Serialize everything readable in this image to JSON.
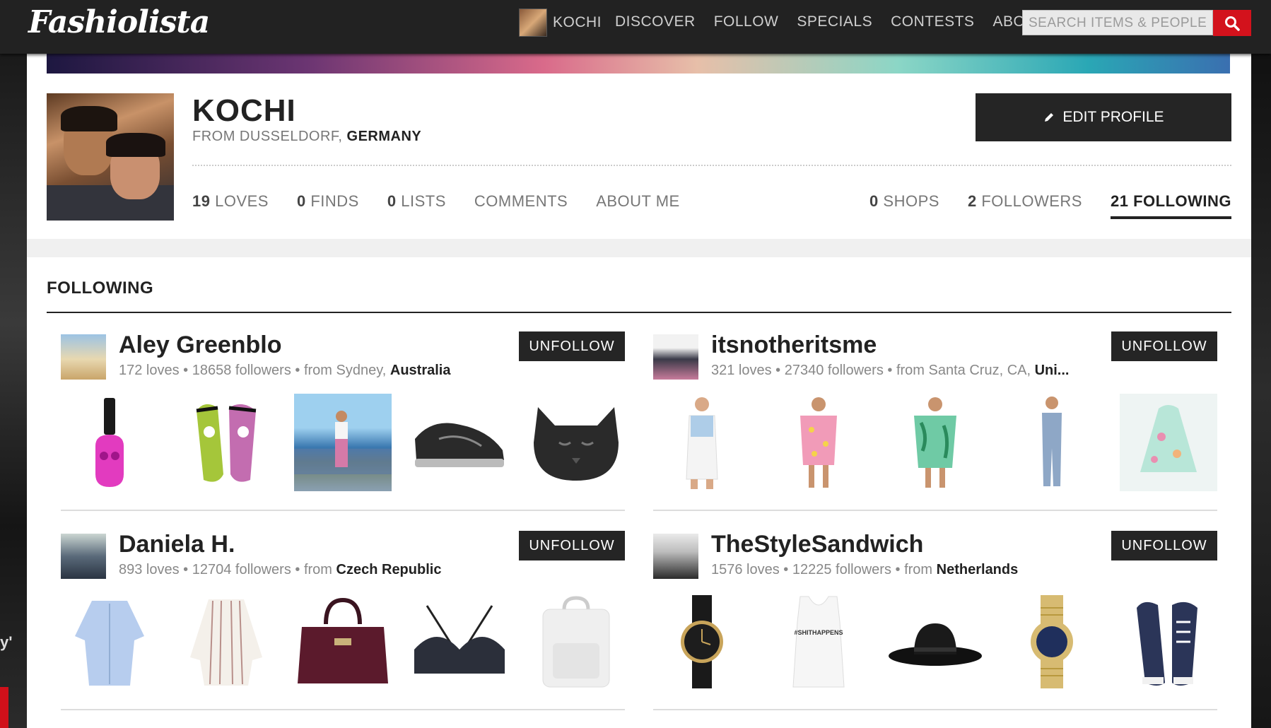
{
  "brand": {
    "logo": "Fashiolista"
  },
  "nav": {
    "user_label": "KOCHI",
    "links": [
      "DISCOVER",
      "FOLLOW",
      "SPECIALS",
      "CONTESTS",
      "ABOUT"
    ],
    "search_placeholder": "SEARCH ITEMS & PEOPLE"
  },
  "profile": {
    "name": "KOCHI",
    "from_prefix": "FROM DUSSELDORF,",
    "country": "GERMANY",
    "edit_label": "EDIT PROFILE",
    "stats_left": [
      {
        "count": "19",
        "label": "LOVES"
      },
      {
        "count": "0",
        "label": "FINDS"
      },
      {
        "count": "0",
        "label": "LISTS"
      },
      {
        "count": "",
        "label": "COMMENTS"
      },
      {
        "count": "",
        "label": "ABOUT ME"
      }
    ],
    "stats_right": [
      {
        "count": "0",
        "label": "SHOPS"
      },
      {
        "count": "2",
        "label": "FOLLOWERS"
      },
      {
        "count": "21",
        "label": "FOLLOWING"
      }
    ]
  },
  "following": {
    "title": "FOLLOWING",
    "unfollow_label": "UNFOLLOW",
    "users": [
      {
        "name": "Aley Greenblo",
        "loves": "172 loves",
        "followers": "18658 followers",
        "from_prefix": "from Sydney,",
        "location": "Australia",
        "items": [
          "pink skull nail polish",
          "zombie slip-on sneakers",
          "street style photo",
          "black running sneaker",
          "cat face handbag"
        ]
      },
      {
        "name": "itsnotheritsme",
        "loves": "321 loves",
        "followers": "27340 followers",
        "from_prefix": "from Santa Cruz, CA,",
        "location": "Uni...",
        "items": [
          "white distressed overalls",
          "pink printed dress",
          "tropical print dress",
          "denim jumpsuit",
          "mint floral skater dress"
        ]
      },
      {
        "name": "Daniela H.",
        "loves": "893 loves",
        "followers": "12704 followers",
        "from_prefix": "from",
        "location": "Czech Republic",
        "items": [
          "light blue shirt",
          "striped oversized shirt",
          "burgundy satchel bag",
          "black lace bralette",
          "white backpack"
        ]
      },
      {
        "name": "TheStyleSandwich",
        "loves": "1576 loves",
        "followers": "12225 followers",
        "from_prefix": "from",
        "location": "Netherlands",
        "items": [
          "black leather watch",
          "#SHITHAPPENS tank top",
          "black wide brim hat",
          "gold wristwatch",
          "navy canvas sneakers"
        ]
      }
    ],
    "tank_print": "#SHITHAPPENS"
  },
  "colors": {
    "brand_red": "#d3121c",
    "dark": "#252525"
  }
}
